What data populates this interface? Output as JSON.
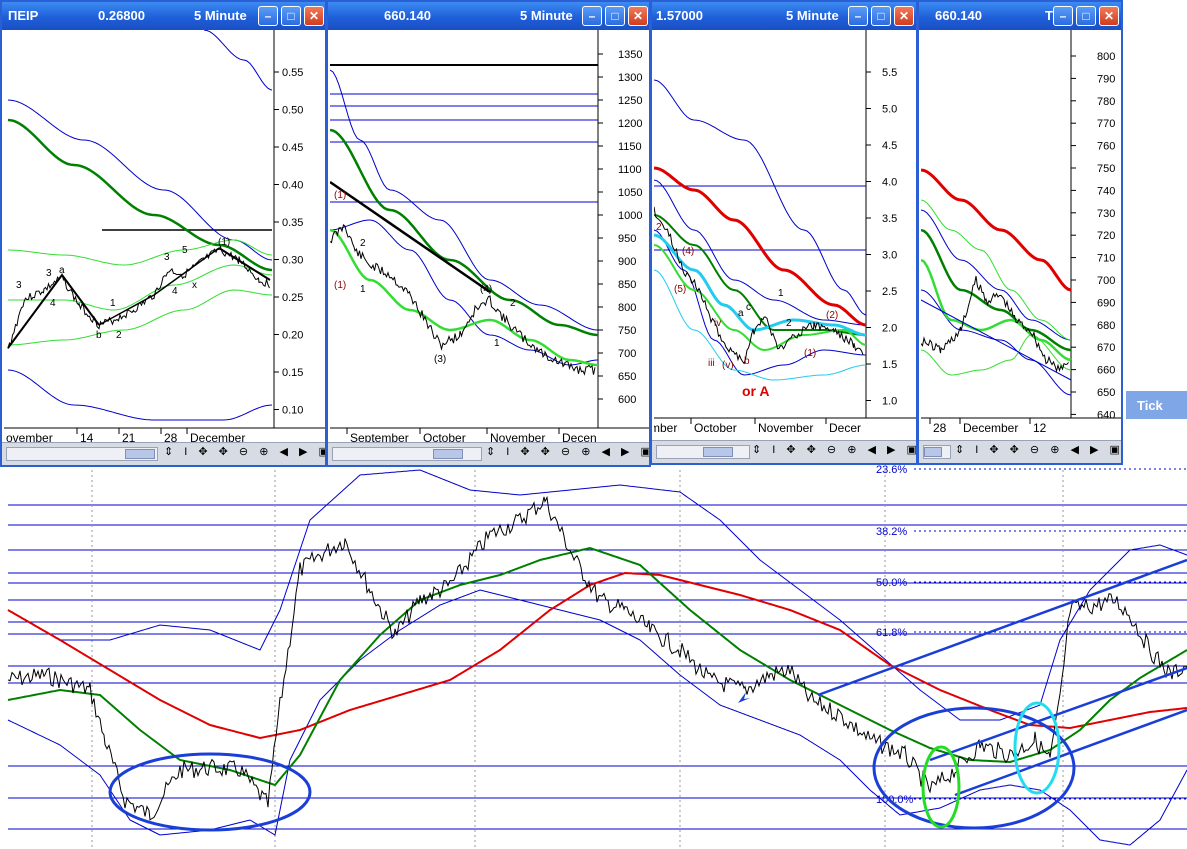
{
  "colors": {
    "title_bar": "#1f5fd9",
    "bollinger": "#0000cc",
    "ma_green": "#008000",
    "ma_red": "#e00000",
    "price": "#000000",
    "fib": "#0000cc"
  },
  "windows": [
    {
      "title_left": "ΠΕΙΡ",
      "title_value": "0.26800",
      "title_period": "5 Minute",
      "y_ticks": [
        "0.55",
        "0.50",
        "0.45",
        "0.40",
        "0.35",
        "0.30",
        "0.25",
        "0.20",
        "0.15",
        "0.10"
      ],
      "x_labels": [
        "ovember",
        "14",
        "21",
        "28",
        "December"
      ],
      "annotations": [
        "3",
        "3",
        "a",
        "4",
        "b",
        "2",
        "1",
        "3",
        "5",
        "4",
        "x",
        "(1)"
      ]
    },
    {
      "title_left": "",
      "title_value": "660.140",
      "title_period": "5 Minute",
      "y_ticks": [
        "1350",
        "1300",
        "1250",
        "1200",
        "1150",
        "1100",
        "1050",
        "1000",
        "950",
        "900",
        "850",
        "800",
        "750",
        "700",
        "650",
        "600"
      ],
      "x_labels": [
        "September",
        "October",
        "November",
        "Decen"
      ],
      "annotations": [
        "(1)",
        "(1)",
        "2",
        "1",
        "(3)",
        "(4)",
        "2",
        "1"
      ]
    },
    {
      "title_left": "",
      "title_value": "1.57000",
      "title_period": "5 Minute",
      "y_ticks": [
        "5.5",
        "5.0",
        "4.5",
        "4.0",
        "3.5",
        "3.0",
        "2.5",
        "2.0",
        "1.5",
        "1.0"
      ],
      "x_labels": [
        "mber",
        "October",
        "November",
        "Decer"
      ],
      "annotations": [
        "2",
        "(5)",
        "(4)",
        "iv",
        "iii",
        "(v)",
        "b",
        "a",
        "c",
        "1",
        "2",
        "(1)",
        "(2)",
        "or A"
      ]
    },
    {
      "title_left": "",
      "title_value": "660.140",
      "title_period": "Tick",
      "y_ticks": [
        "800",
        "790",
        "780",
        "770",
        "760",
        "750",
        "740",
        "730",
        "720",
        "710",
        "700",
        "690",
        "680",
        "670",
        "660",
        "650",
        "640"
      ],
      "x_labels": [
        "28",
        "December",
        "12"
      ],
      "annotations": []
    }
  ],
  "background_tab_label": "Tick",
  "main_chart": {
    "fib_levels": [
      {
        "label": "23.6%"
      },
      {
        "label": "38.2%"
      },
      {
        "label": "50.0%"
      },
      {
        "label": "61.8%"
      },
      {
        "label": "100.0%"
      }
    ]
  }
}
